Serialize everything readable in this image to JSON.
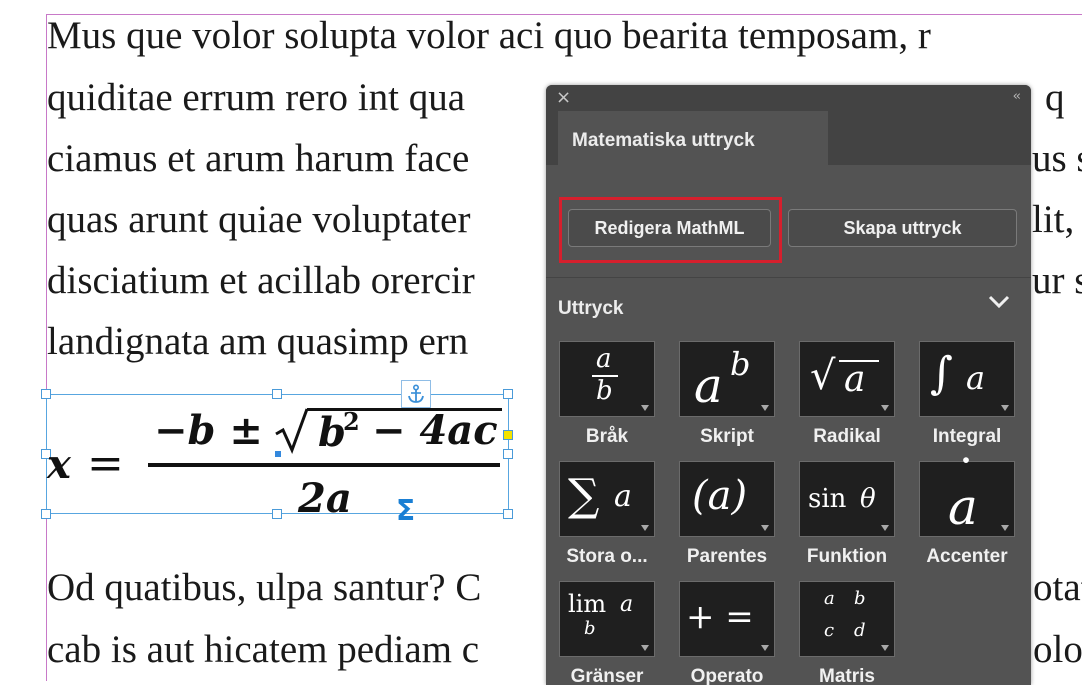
{
  "document": {
    "lines_top": [
      "Mus que volor solupta volor aci quo bearita temposam, r",
      "quiditae errum rero int qua",
      "ciamus et arum harum face",
      "quas arunt quiae voluptater",
      "disciatium et acillab orercir",
      "landignata am quasimp ern"
    ],
    "lines_top_right": [
      "",
      "q",
      "us s",
      "lit,",
      "ur s",
      ""
    ],
    "lines_bottom": [
      "Od quatibus, ulpa santur? C",
      "cab is aut hicatem pediam c"
    ],
    "lines_bottom_right": [
      "otat",
      "olor"
    ],
    "equation": {
      "lhs": "x",
      "equals": "=",
      "numerator_prefix": "−b ±",
      "radicand": "b",
      "exponent": "2",
      "radicand_rest": "− 4ac",
      "denominator": "2a",
      "sigma": "Σ"
    }
  },
  "panel": {
    "close": "×",
    "collapse": "‹‹",
    "tab_label": "Matematiska uttryck",
    "buttons": {
      "edit_mathml": "Redigera MathML",
      "create_expression": "Skapa uttryck"
    },
    "section_label": "Uttryck",
    "tiles": [
      {
        "label": "Bråk",
        "icon": "fraction-icon"
      },
      {
        "label": "Skript",
        "icon": "script-icon"
      },
      {
        "label": "Radikal",
        "icon": "radical-icon"
      },
      {
        "label": "Integral",
        "icon": "integral-icon"
      },
      {
        "label": "Stora o...",
        "icon": "large-operator-icon"
      },
      {
        "label": "Parentes",
        "icon": "parentheses-icon"
      },
      {
        "label": "Funktion",
        "icon": "function-icon"
      },
      {
        "label": "Accenter",
        "icon": "accent-icon"
      },
      {
        "label": "Gränser",
        "icon": "limits-icon"
      },
      {
        "label": "Operato",
        "icon": "operator-icon"
      },
      {
        "label": "Matris",
        "icon": "matrix-icon"
      }
    ],
    "glyphs": {
      "frac_num": "a",
      "frac_den": "b",
      "script_base": "a",
      "script_sup": "b",
      "radical_sign": "√",
      "radical_arg": "a",
      "integral_sign": "∫",
      "integral_arg": "a",
      "sum_sign": "∑",
      "sum_arg": "a",
      "paren": "(a)",
      "func": "sin",
      "func_arg": "θ",
      "accent_dot": "˙",
      "accent_base": "a",
      "lim": "lim",
      "lim_arg": "a",
      "lim_sub": "b",
      "ops": "+ =",
      "m11": "a",
      "m12": "b",
      "m21": "c",
      "m22": "d"
    }
  },
  "colors": {
    "page_edge": "#c879c8",
    "frame": "#58a6e0",
    "highlight": "#d61f2d",
    "panel_bg": "#535353",
    "sigma": "#1a7fd4"
  }
}
